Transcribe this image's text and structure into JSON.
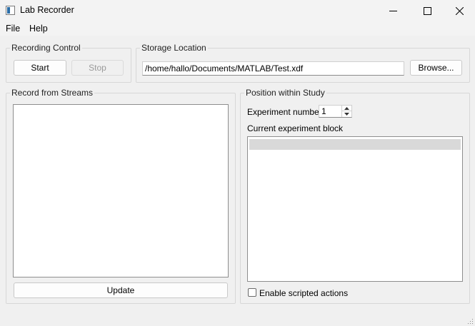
{
  "window": {
    "title": "Lab Recorder"
  },
  "menu": {
    "items": [
      "File",
      "Help"
    ]
  },
  "recording_control": {
    "title": "Recording Control",
    "start_label": "Start",
    "stop_label": "Stop"
  },
  "storage_location": {
    "title": "Storage Location",
    "path": "/home/hallo/Documents/MATLAB/Test.xdf",
    "browse_label": "Browse..."
  },
  "record_streams": {
    "title": "Record from Streams",
    "update_label": "Update"
  },
  "study_position": {
    "title": "Position within Study",
    "experiment_number_label": "Experiment number",
    "experiment_number_value": "1",
    "current_block_label": "Current experiment block",
    "scripted_actions_label": "Enable scripted actions",
    "scripted_actions_checked": false
  }
}
